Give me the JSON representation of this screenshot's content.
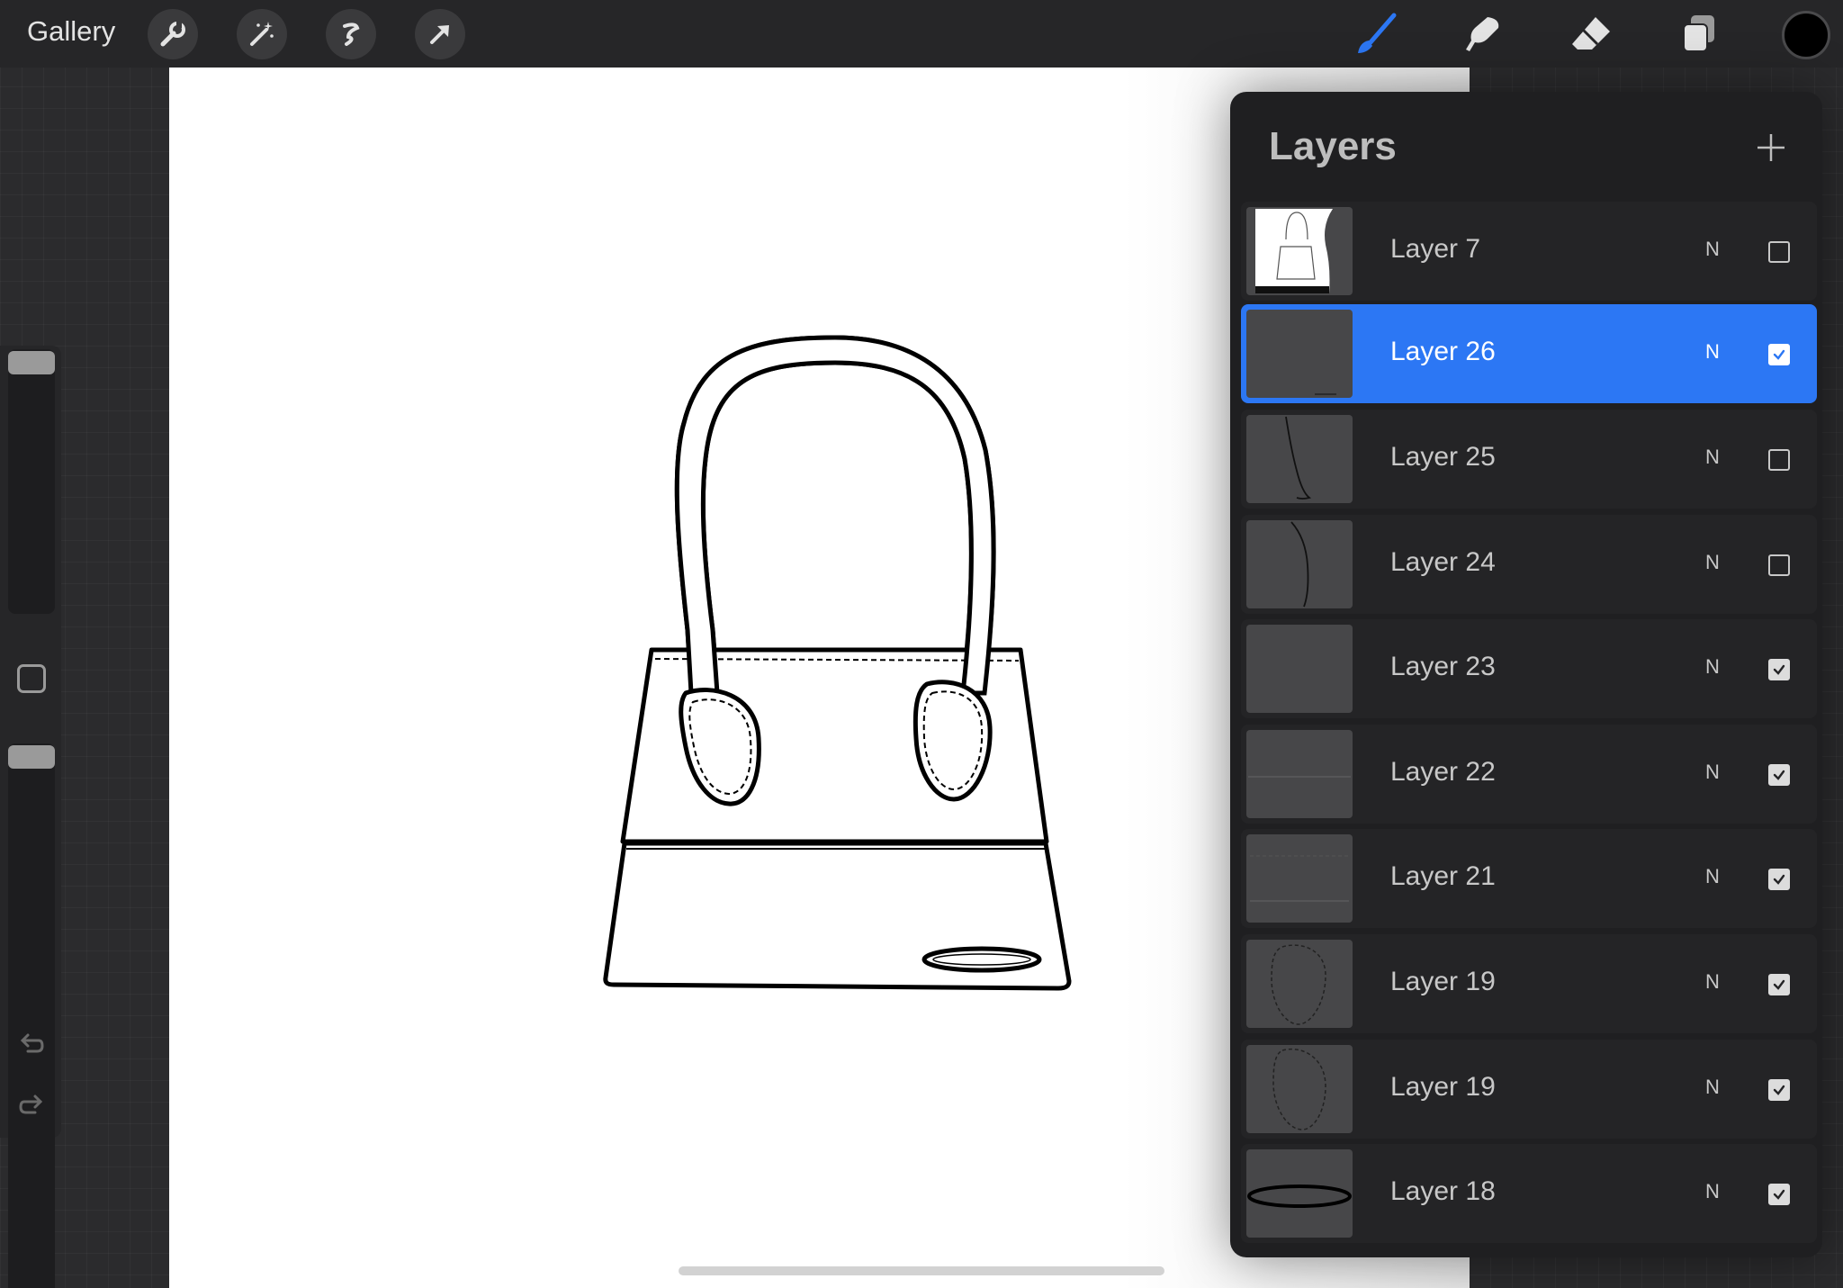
{
  "app": {
    "gallery_label": "Gallery"
  },
  "toolbar": {
    "left_tools": [
      "wrench-icon",
      "magic-wand-icon",
      "selection-icon",
      "transform-arrow-icon"
    ],
    "right_tools": [
      "brush-icon",
      "smudge-icon",
      "eraser-icon",
      "layers-icon"
    ],
    "active_tool": "brush-icon",
    "current_color": "#000000",
    "accent_color": "#2c77f4"
  },
  "sidebar": {
    "brush_size_level": 0.95,
    "opacity_level": 0.95
  },
  "layers_panel": {
    "title": "Layers",
    "layers": [
      {
        "name": "Layer 7",
        "mode": "N",
        "visible": false,
        "selected": false
      },
      {
        "name": "Layer 26",
        "mode": "N",
        "visible": true,
        "selected": true
      },
      {
        "name": "Layer 25",
        "mode": "N",
        "visible": false,
        "selected": false
      },
      {
        "name": "Layer 24",
        "mode": "N",
        "visible": false,
        "selected": false
      },
      {
        "name": "Layer 23",
        "mode": "N",
        "visible": true,
        "selected": false
      },
      {
        "name": "Layer 22",
        "mode": "N",
        "visible": true,
        "selected": false
      },
      {
        "name": "Layer 21",
        "mode": "N",
        "visible": true,
        "selected": false
      },
      {
        "name": "Layer 19",
        "mode": "N",
        "visible": true,
        "selected": false
      },
      {
        "name": "Layer 19",
        "mode": "N",
        "visible": true,
        "selected": false
      },
      {
        "name": "Layer 18",
        "mode": "N",
        "visible": true,
        "selected": false
      }
    ]
  }
}
